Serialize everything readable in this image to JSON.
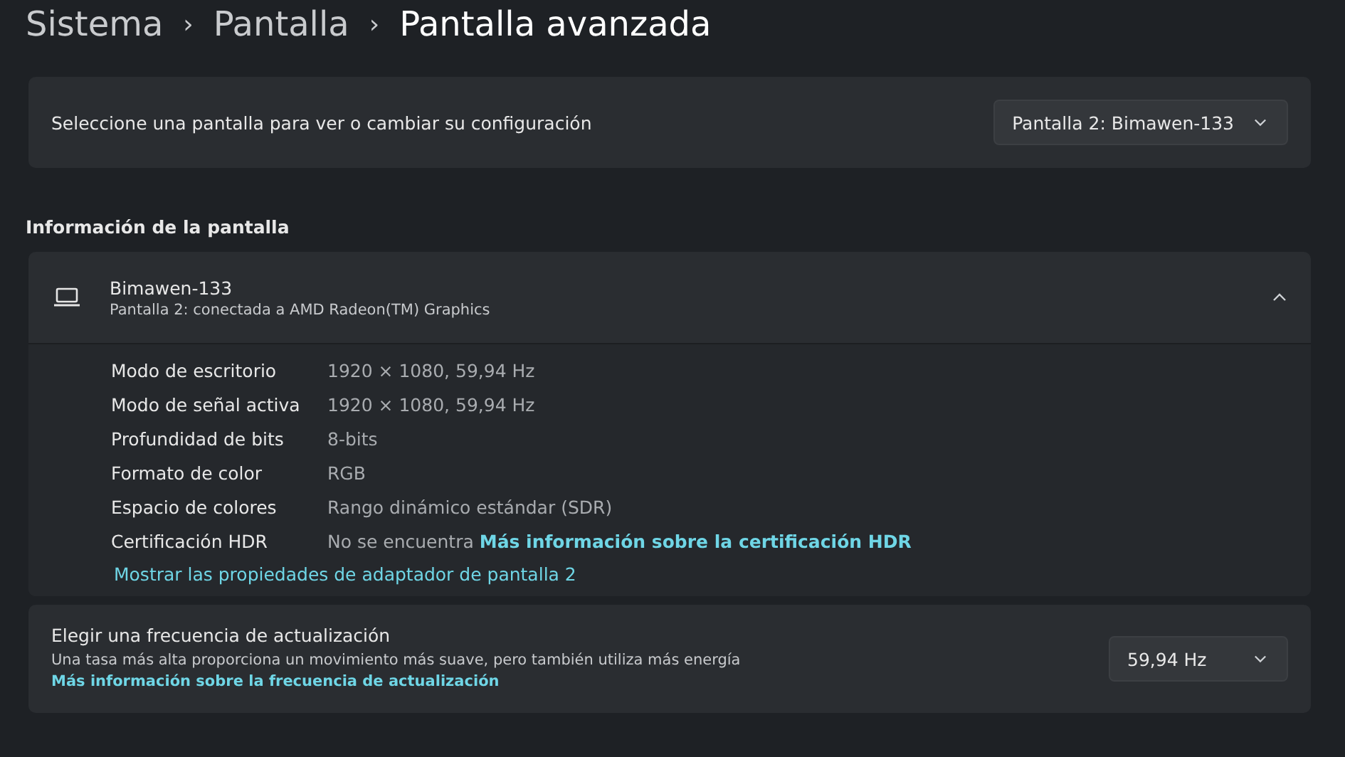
{
  "breadcrumb": [
    {
      "label": "Sistema",
      "selected": false
    },
    {
      "label": "Pantalla",
      "selected": false
    },
    {
      "label": "Pantalla avanzada",
      "selected": true
    }
  ],
  "breadcrumb_separator": "›",
  "display_select": {
    "label": "Seleccione una pantalla para ver o cambiar su configuración",
    "value": "Pantalla 2: Bimawen-133"
  },
  "section_title": "Información de la pantalla",
  "display_info": {
    "name": "Bimawen-133",
    "subtitle": "Pantalla 2: conectada a AMD Radeon(TM) Graphics",
    "expanded": true,
    "rows": [
      {
        "label": "Modo de escritorio",
        "value": "1920 × 1080, 59,94 Hz"
      },
      {
        "label": "Modo de señal activa",
        "value": "1920 × 1080, 59,94 Hz"
      },
      {
        "label": "Profundidad de bits",
        "value": "8-bits"
      },
      {
        "label": "Formato de color",
        "value": "RGB"
      },
      {
        "label": "Espacio de colores",
        "value": "Rango dinámico estándar (SDR)"
      },
      {
        "label": "Certificación HDR",
        "value": "No se encuentra",
        "link": "Más información sobre la certificación HDR"
      }
    ],
    "adapter_link": "Mostrar las propiedades de adaptador de pantalla 2"
  },
  "refresh_rate": {
    "title": "Elegir una frecuencia de actualización",
    "description": "Una tasa más alta proporciona un movimiento más suave, pero también utiliza más energía",
    "link": "Más información sobre la frecuencia de actualización",
    "value": "59,94 Hz"
  }
}
